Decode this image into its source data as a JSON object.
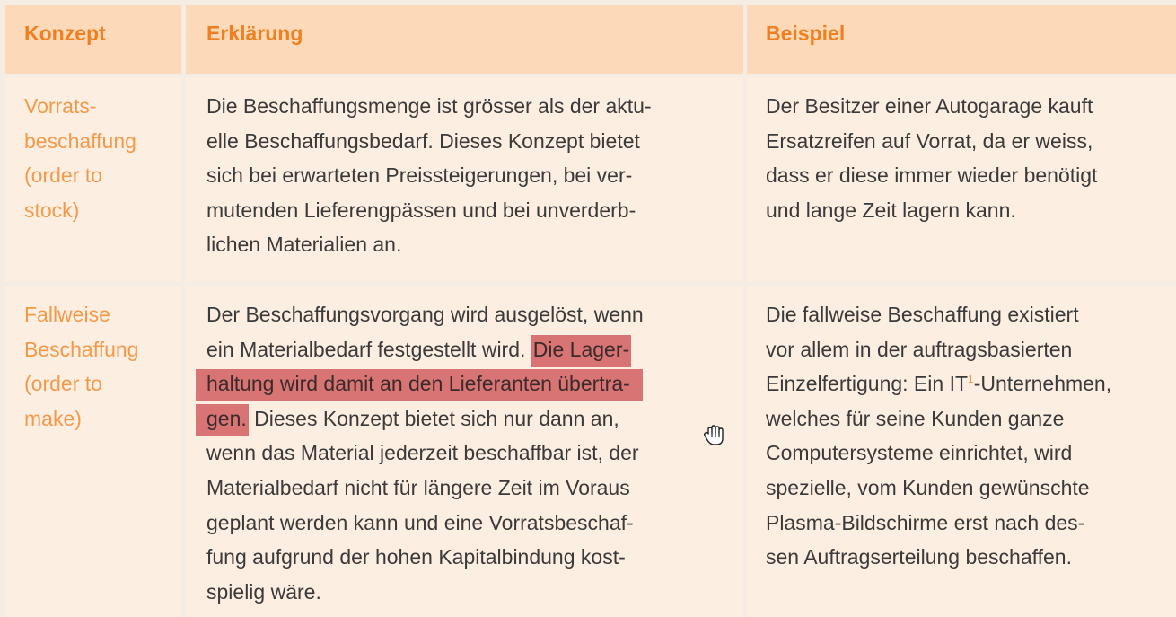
{
  "table": {
    "headers": {
      "concept": "Konzept",
      "explanation": "Erklärung",
      "example": "Beispiel"
    },
    "rows": [
      {
        "concept_lines": [
          "Vorrats-",
          "beschaffung",
          "(order to",
          "stock)"
        ],
        "explanation_lines": [
          "Die Beschaffungsmenge ist grösser als der aktu-",
          "elle Beschaffungsbedarf. Dieses Konzept bietet",
          "sich bei erwarteten Preissteigerungen, bei ver-",
          "mutenden Lieferengpässen und bei unverderb-",
          "lichen Materialien an."
        ],
        "example_lines": [
          "Der Besitzer einer Autogarage kauft",
          "Ersatzreifen auf Vorrat, da er weiss,",
          "dass er diese immer wieder benötigt",
          "und lange Zeit lagern kann."
        ]
      },
      {
        "concept_lines": [
          "Fallweise",
          "Beschaffung",
          "(order to",
          "make)"
        ],
        "explanation_lines": {
          "l1": "Der Beschaffungsvorgang wird ausgelöst, wenn",
          "l2_plain": "ein  Materialbedarf festgestellt wird.",
          "l2_hl": "Die Lager-",
          "l3_hl": "haltung wird damit an den Lieferanten übertra-",
          "l4_hl": "gen.",
          "l4_plain": "Dieses Konzept bietet sich nur dann an,",
          "l5": "wenn das Material jederzeit beschaffbar ist, der",
          "l6": "Materialbedarf nicht für längere Zeit im Voraus",
          "l7": "geplant werden kann und eine Vorratsbeschaf-",
          "l8": "fung aufgrund der hohen Kapitalbindung kost-",
          "l9": "spielig wäre."
        },
        "example_lines": {
          "l1": "Die fallweise Beschaffung existiert",
          "l2": "vor allem in der auftragsbasierten",
          "l3_pre": "Einzelfertigung: Ein IT",
          "l3_sup": "1",
          "l3_post": "-Unternehmen,",
          "l4": "welches für seine Kunden ganze",
          "l5": "Computersysteme einrichtet, wird",
          "l6": "spezielle, vom Kunden gewünschte",
          "l7": "Plasma-Bildschirme erst nach des-",
          "l8": "sen Auftragserteilung beschaffen."
        }
      }
    ]
  },
  "colors": {
    "header_bg": "#fcd9b8",
    "body_bg": "#fdeee2",
    "accent": "#f07f1f",
    "highlight": "#d97474"
  },
  "icons": {
    "cursor": "hand-cursor-icon"
  }
}
